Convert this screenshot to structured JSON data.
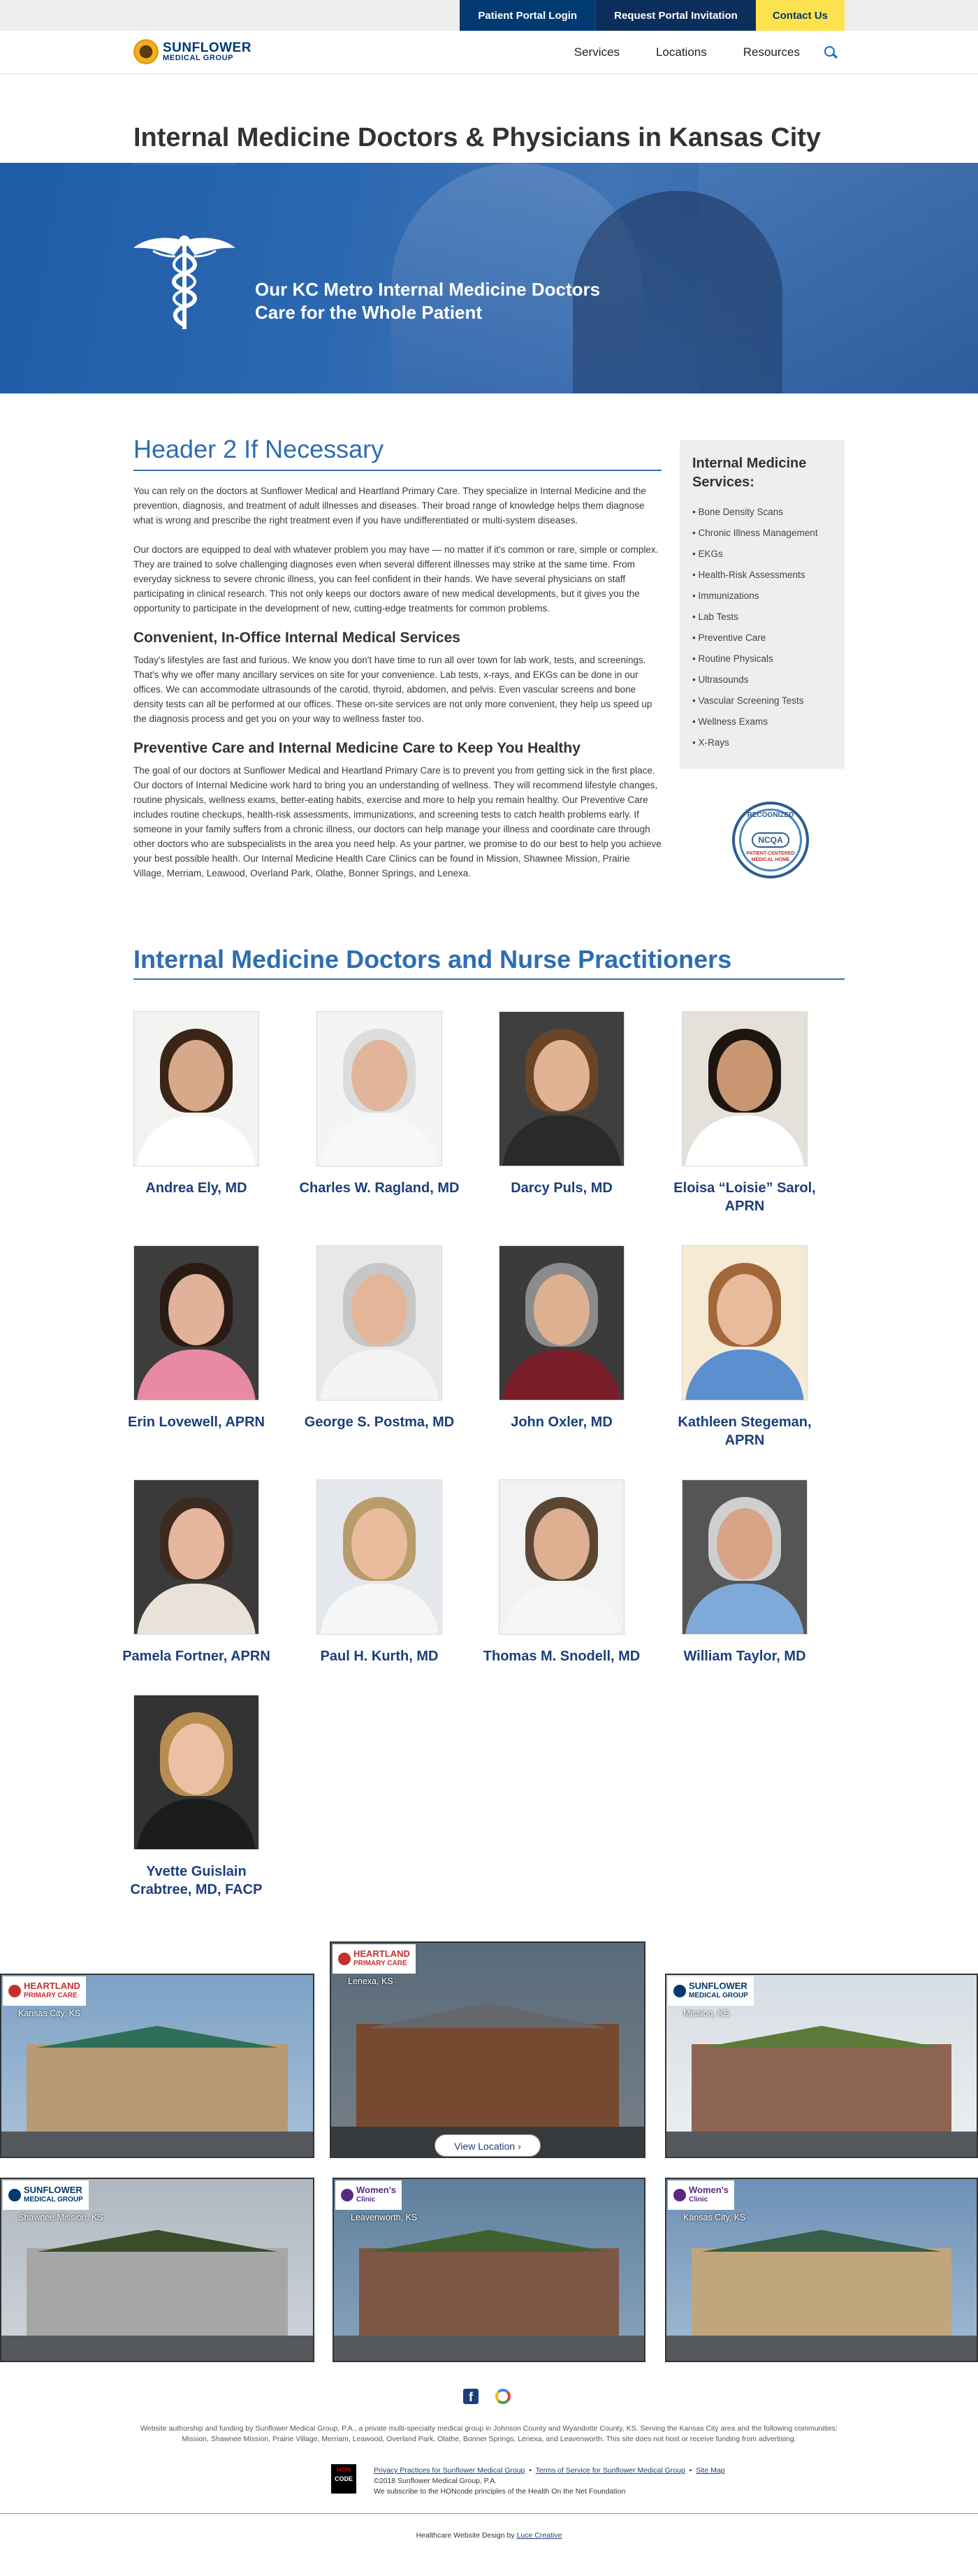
{
  "topbar": {
    "portal_login": "Patient Portal Login",
    "portal_invite": "Request Portal Invitation",
    "contact": "Contact Us"
  },
  "brand": {
    "name": "SUNFLOWER",
    "sub": "MEDICAL GROUP",
    "accent": "#003a70",
    "highlight": "#fde24f"
  },
  "nav": {
    "items": [
      "Services",
      "Locations",
      "Resources"
    ],
    "search_icon": "search-icon"
  },
  "page_title": "Internal Medicine Doctors & Physicians in Kansas City",
  "hero": {
    "line1": "Our KC Metro Internal Medicine Doctors",
    "line2": "Care for the Whole Patient",
    "icon": "caduceus-icon"
  },
  "content": {
    "h2": "Header 2 If Necessary",
    "p1": "You can rely on the doctors at Sunflower Medical and Heartland Primary Care. They specialize in Internal Medicine and the prevention, diagnosis, and treatment of adult illnesses and diseases. Their broad range of knowledge helps them diagnose what is wrong and prescribe the right treatment even if you have undifferentiated or multi-system diseases.",
    "p2": "Our doctors are equipped to deal with whatever problem you may have — no matter if it's common or rare, simple or complex. They are trained to solve challenging diagnoses even when several different illnesses may strike at the same time. From everyday sickness to severe chronic illness, you can feel confident in their hands. We have several physicians on staff participating in clinical research. This not only keeps our doctors aware of new medical developments, but it gives you the opportunity to participate in the development of new, cutting-edge treatments for common problems.",
    "h3a": "Convenient, In-Office Internal Medical Services",
    "p3": "Today's lifestyles are fast and furious. We know you don't have time to run all over town for lab work, tests, and screenings. That's why we offer many ancillary services on site for your convenience. Lab tests, x-rays, and EKGs can be done in our offices. We can accommodate ultrasounds of the carotid, thyroid, abdomen, and pelvis. Even vascular screens and bone density tests can all be performed at our offices. These on-site services are not only more convenient, they help us speed up the diagnosis process and get you on your way to wellness faster too.",
    "h3b": "Preventive Care and Internal Medicine Care to Keep You Healthy",
    "p4": "The goal of our doctors at Sunflower Medical and Heartland Primary Care is to prevent you from getting sick in the first place. Our doctors of Internal Medicine work hard to bring you an understanding of wellness. They will recommend lifestyle changes, routine physicals, wellness exams, better-eating habits, exercise and more to help you remain healthy. Our Preventive Care includes routine checkups, health-risk assessments, immunizations, and screening tests to catch health problems early. If someone in your family suffers from a chronic illness, our doctors can help manage your illness and coordinate care through other doctors who are subspecialists in the area you need help. As your partner, we promise to do our best to help you achieve your best possible health. Our Internal Medicine Health Care Clinics can be found in Mission, Shawnee Mission, Prairie Village, Merriam, Leawood, Overland Park, Olathe, Bonner Springs, and Lenexa."
  },
  "sidebar": {
    "title": "Internal Medicine Services:",
    "items": [
      "Bone Density Scans",
      "Chronic Illness Management",
      "EKGs",
      "Health-Risk Assessments",
      "Immunizations",
      "Lab Tests",
      "Preventive Care",
      "Routine Physicals",
      "Ultrasounds",
      "Vascular Screening Tests",
      "Wellness Exams",
      "X-Rays"
    ]
  },
  "ncqa": {
    "top": "RECOGNIZED",
    "mid": "NCQA",
    "bottom": "PATIENT-CENTERED MEDICAL HOME"
  },
  "team": {
    "title": "Internal Medicine Doctors and Nurse Practitioners",
    "doctors": [
      {
        "name": "Andrea Ely, MD"
      },
      {
        "name": "Charles W. Ragland, MD"
      },
      {
        "name": "Darcy Puls, MD"
      },
      {
        "name": "Eloisa “Loisie” Sarol, APRN"
      },
      {
        "name": "Erin Lovewell, APRN"
      },
      {
        "name": "George S. Postma, MD"
      },
      {
        "name": "John Oxler, MD"
      },
      {
        "name": "Kathleen Stegeman, APRN"
      },
      {
        "name": "Pamela Fortner, APRN"
      },
      {
        "name": "Paul H. Kurth, MD"
      },
      {
        "name": "Thomas M. Snodell, MD"
      },
      {
        "name": "William Taylor, MD"
      },
      {
        "name": "Yvette Guislain Crabtree, MD, FACP"
      }
    ]
  },
  "locations": [
    {
      "brand": "HEARTLAND",
      "brand2": "PRIMARY CARE",
      "city": "Kansas City, KS"
    },
    {
      "brand": "HEARTLAND",
      "brand2": "PRIMARY CARE",
      "city": "Lenexa, KS"
    },
    {
      "brand": "SUNFLOWER",
      "brand2": "MEDICAL GROUP",
      "city": "Mission, KS"
    },
    {
      "brand": "SUNFLOWER",
      "brand2": "MEDICAL GROUP",
      "city": "Shawnee Mission, KS"
    },
    {
      "brand": "Women's",
      "brand2": "Clinic",
      "city": "Leavenworth, KS"
    },
    {
      "brand": "Women's",
      "brand2": "Clinic",
      "city": "Kansas City, KS"
    }
  ],
  "view_location": "View Location ›",
  "footer": {
    "disclaimer1": "Website authorship and funding by Sunflower Medical Group, P.A., a private multi-specialty medical group in Johnson County and Wyandotte County, KS. Serving the Kansas City area and the following communities:",
    "disclaimer2": "Mission, Shawnee Mission, Prairie Village, Merriam, Leawood, Overland Park, Olathe, Bonner Springs, Lenexa, and Leavenworth. This site does not host or receive funding from advertising.",
    "privacy": "Privacy Practices for Sunflower Medical Group",
    "terms": "Terms of Service for Sunflower Medical Group",
    "sitemap": "Site Map",
    "copyright": "©2018 Sunflower Medical Group, P.A.",
    "hon": "We subscribe to the HONcode principles of the Health On the Net Foundation",
    "hon_badge1": "HON",
    "hon_badge2": "CODE",
    "credit_prefix": "Healthcare Website Design by ",
    "credit_link": "Luce Creative"
  }
}
